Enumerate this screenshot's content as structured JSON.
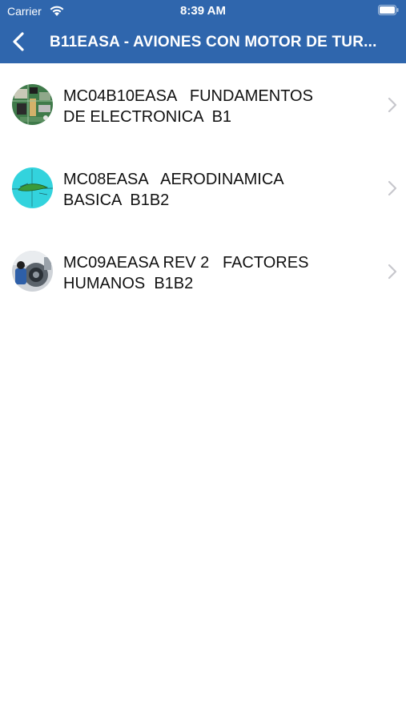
{
  "status_bar": {
    "carrier": "Carrier",
    "time": "8:39 AM",
    "icons": [
      "wifi-icon",
      "battery-icon"
    ]
  },
  "nav": {
    "back_icon": "chevron-left-icon",
    "title": "B11EASA - AVIONES CON MOTOR DE TUR..."
  },
  "colors": {
    "nav_background": "#2f66ad",
    "text": "#111111",
    "chevron": "#c7c7cc"
  },
  "list": {
    "items": [
      {
        "line1": "MC04B10EASA   FUNDAMENTOS",
        "line2": "DE ELECTRONICA  B1",
        "thumbnail": "circuit-board-image"
      },
      {
        "line1": "MC08EASA   AERODINAMICA",
        "line2": "BASICA  B1B2",
        "thumbnail": "airfoil-diagram-image"
      },
      {
        "line1": "MC09AEASA REV 2   FACTORES",
        "line2": "HUMANOS  B1B2",
        "thumbnail": "engine-mechanic-image"
      }
    ],
    "disclosure_icon": "chevron-right-icon"
  }
}
